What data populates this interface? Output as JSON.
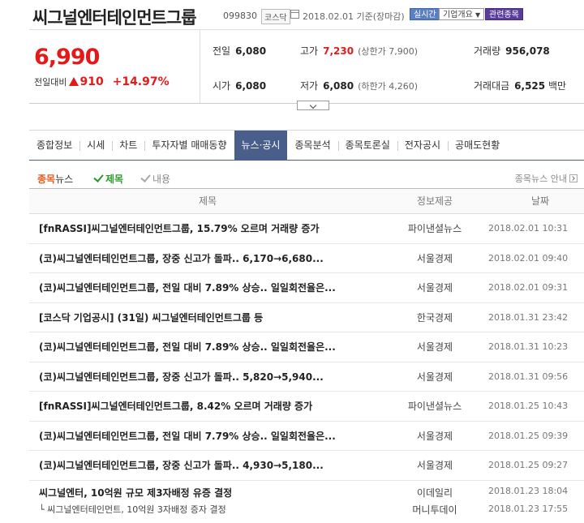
{
  "header": {
    "company_name": "씨그널엔터테인먼트그룹",
    "stock_code": "099830",
    "market": "코스닥",
    "date_basis": "2018.02.01 기준(장마감)",
    "buttons": {
      "realtime": "실시간",
      "company_overview": "기업개요",
      "related_stocks": "관련종목"
    }
  },
  "price": {
    "current": "6,990",
    "change_label": "전일대비",
    "change_amount": "910",
    "change_percent": "+14.97%",
    "direction": "up",
    "colors": {
      "up": "#e21a1a"
    }
  },
  "stats": {
    "prev_close": {
      "label": "전일",
      "value": "6,080"
    },
    "high": {
      "label": "고가",
      "value": "7,230",
      "sub": "(상한가 7,900)"
    },
    "volume": {
      "label": "거래량",
      "value": "956,078"
    },
    "open": {
      "label": "시가",
      "value": "6,080"
    },
    "low": {
      "label": "저가",
      "value": "6,080",
      "sub": "(하한가 4,260)"
    },
    "amount": {
      "label": "거래대금",
      "value": "6,525",
      "unit": "백만"
    }
  },
  "tabs": [
    {
      "label": "종합정보"
    },
    {
      "label": "시세"
    },
    {
      "label": "차트"
    },
    {
      "label": "투자자별 매매동향"
    },
    {
      "label": "뉴스·공시",
      "active": true
    },
    {
      "label": "종목분석"
    },
    {
      "label": "종목토론실"
    },
    {
      "label": "전자공시"
    },
    {
      "label": "공매도현황"
    }
  ],
  "news_header": {
    "title_part1": "종목",
    "title_part2": "뉴스",
    "option_title": "제목",
    "option_content": "내용",
    "guide": "종목뉴스 안내"
  },
  "columns": {
    "title": "제목",
    "source": "정보제공",
    "date": "날짜"
  },
  "news": [
    {
      "title": "[fnRASSI]씨그널엔터테인먼트그룹, 15.79% 오르며 거래량 증가",
      "source": "파이낸셜뉴스",
      "date": "2018.02.01 10:31"
    },
    {
      "title": "(코)씨그널엔터테인먼트그룹, 장중 신고가 돌파.. 6,170→6,680...",
      "source": "서울경제",
      "date": "2018.02.01 09:40"
    },
    {
      "title": "(코)씨그널엔터테인먼트그룹, 전일 대비 7.89% 상승.. 일일회전율은...",
      "source": "서울경제",
      "date": "2018.02.01 09:31"
    },
    {
      "title": "[코스닥 기업공시] (31일) 씨그널엔터테인먼트그룹 등",
      "source": "한국경제",
      "date": "2018.01.31 23:42"
    },
    {
      "title": "(코)씨그널엔터테인먼트그룹, 전일 대비 7.89% 상승.. 일일회전율은...",
      "source": "서울경제",
      "date": "2018.01.31 10:23"
    },
    {
      "title": "(코)씨그널엔터테인먼트그룹, 장중 신고가 돌파.. 5,820→5,940...",
      "source": "서울경제",
      "date": "2018.01.31 09:56"
    },
    {
      "title": "[fnRASSI]씨그널엔터테인먼트그룹, 8.42% 오르며 거래량 증가",
      "source": "파이낸셜뉴스",
      "date": "2018.01.25 10:43"
    },
    {
      "title": "(코)씨그널엔터테인먼트그룹, 전일 대비 7.79% 상승.. 일일회전율은...",
      "source": "서울경제",
      "date": "2018.01.25 09:39"
    },
    {
      "title": "(코)씨그널엔터테인먼트그룹, 장중 신고가 돌파.. 4,930→5,180...",
      "source": "서울경제",
      "date": "2018.01.25 09:27"
    }
  ],
  "last_news": {
    "title": "씨그널엔터, 10억원 규모 제3자배정 유증 결정",
    "source": "이데일리",
    "date": "2018.01.23 18:04",
    "related": {
      "title": "└ 씨그널엔터테인먼트, 10억원 3자배정 증자 결정",
      "source": "머니투데이",
      "date": "2018.01.23 17:55"
    }
  }
}
